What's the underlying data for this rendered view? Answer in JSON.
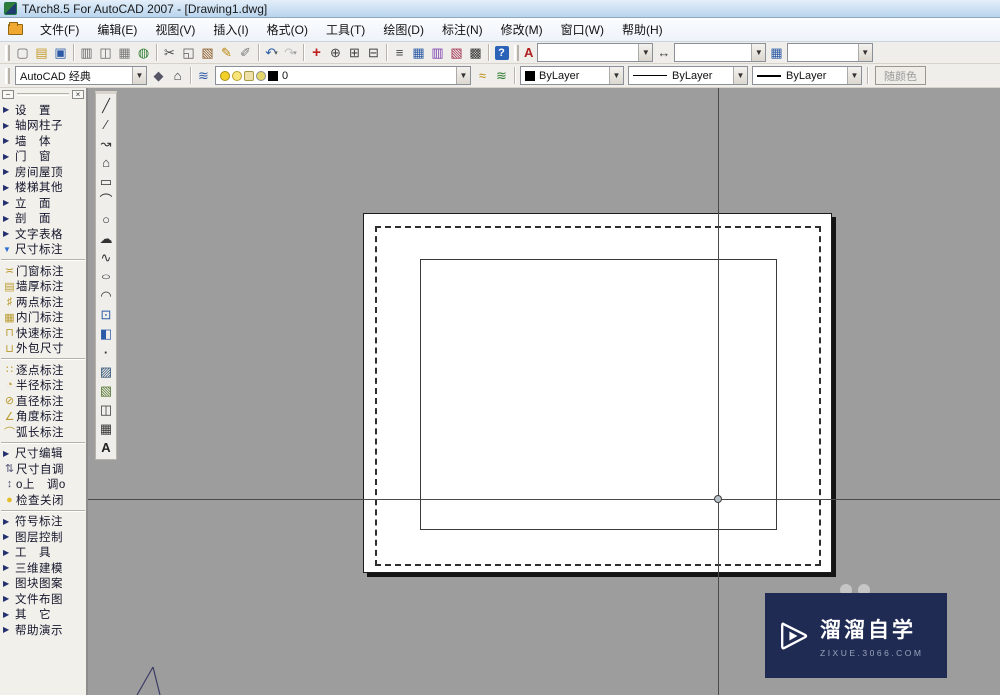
{
  "window": {
    "title": "TArch8.5 For AutoCAD 2007 - [Drawing1.dwg]"
  },
  "menu": {
    "items": [
      {
        "key": "file",
        "label": "文件(F)"
      },
      {
        "key": "edit",
        "label": "编辑(E)"
      },
      {
        "key": "view",
        "label": "视图(V)"
      },
      {
        "key": "insert",
        "label": "插入(I)"
      },
      {
        "key": "format",
        "label": "格式(O)"
      },
      {
        "key": "tools",
        "label": "工具(T)"
      },
      {
        "key": "draw",
        "label": "绘图(D)"
      },
      {
        "key": "dimension",
        "label": "标注(N)"
      },
      {
        "key": "modify",
        "label": "修改(M)"
      },
      {
        "key": "window",
        "label": "窗口(W)"
      },
      {
        "key": "help",
        "label": "帮助(H)"
      }
    ]
  },
  "toolbars": {
    "standard": {
      "items": [
        {
          "key": "new-file",
          "glyph": "▢",
          "color": "#6a6a6a"
        },
        {
          "key": "open-file",
          "glyph": "▤",
          "color": "#c49a2c"
        },
        {
          "key": "save-file",
          "glyph": "▣",
          "color": "#2b5aa6"
        },
        {
          "sep": true
        },
        {
          "key": "plot",
          "glyph": "▥",
          "color": "#666666"
        },
        {
          "key": "plot-preview",
          "glyph": "◫",
          "color": "#666666"
        },
        {
          "key": "publish",
          "glyph": "▦",
          "color": "#777777"
        },
        {
          "key": "web",
          "glyph": "◍",
          "color": "#2e7d32"
        },
        {
          "sep": true
        },
        {
          "key": "cut",
          "glyph": "✂",
          "color": "#444444"
        },
        {
          "key": "copy",
          "glyph": "◱",
          "color": "#555555"
        },
        {
          "key": "paste",
          "glyph": "▧",
          "color": "#8b5a2b"
        },
        {
          "key": "match-properties",
          "glyph": "✎",
          "color": "#b8860b"
        },
        {
          "key": "block-editor",
          "glyph": "✐",
          "color": "#7a7a7a"
        },
        {
          "sep": true
        },
        {
          "key": "undo",
          "glyph": "↶",
          "color": "#2b5aa6",
          "dropdown": true
        },
        {
          "key": "redo",
          "glyph": "↷",
          "color": "#9a9a9a",
          "dropdown": true,
          "disabled": true
        },
        {
          "sep": true
        },
        {
          "key": "pan",
          "glyph": "+",
          "color": "#c02020",
          "cls": "bold"
        },
        {
          "key": "zoom-realtime",
          "glyph": "⊕",
          "color": "#444444"
        },
        {
          "key": "zoom-window",
          "glyph": "⊞",
          "color": "#444444"
        },
        {
          "key": "zoom-previous",
          "glyph": "⊟",
          "color": "#444444"
        },
        {
          "sep": true
        },
        {
          "key": "properties",
          "glyph": "≡",
          "color": "#444444"
        },
        {
          "key": "designcenter",
          "glyph": "▦",
          "color": "#2b5aa6"
        },
        {
          "key": "tool-palettes",
          "glyph": "▥",
          "color": "#7a3db0"
        },
        {
          "key": "markup",
          "glyph": "▧",
          "color": "#a03050"
        },
        {
          "key": "quickcalc",
          "glyph": "▩",
          "color": "#333333"
        },
        {
          "sep": true
        },
        {
          "key": "help",
          "glyph": "?",
          "cls": "help"
        }
      ]
    },
    "styles": {
      "text_style": "",
      "dim_style": "",
      "table_style": ""
    },
    "workspace": {
      "value": "AutoCAD 经典"
    },
    "layers": {
      "current_layer": "0"
    },
    "properties": {
      "color": "ByLayer",
      "linetype": "ByLayer",
      "lineweight": "ByLayer",
      "plot_style": "随颜色"
    }
  },
  "draw_toolbar": {
    "items": [
      {
        "key": "line",
        "glyph": "╱",
        "color": "#333333"
      },
      {
        "key": "construction-line",
        "glyph": "∕",
        "color": "#333333"
      },
      {
        "key": "polyline",
        "glyph": "↝",
        "color": "#333333"
      },
      {
        "key": "polygon",
        "glyph": "⌂",
        "color": "#333333"
      },
      {
        "key": "rectangle",
        "glyph": "▭",
        "color": "#333333"
      },
      {
        "key": "arc",
        "glyph": "⌒",
        "color": "#333333"
      },
      {
        "key": "circle",
        "glyph": "○",
        "color": "#333333"
      },
      {
        "key": "revision-cloud",
        "glyph": "☁",
        "color": "#333333"
      },
      {
        "key": "spline",
        "glyph": "∿",
        "color": "#333333"
      },
      {
        "key": "ellipse",
        "glyph": "○",
        "color": "#333333",
        "cls": "stretch"
      },
      {
        "key": "ellipse-arc",
        "glyph": "◠",
        "color": "#333333"
      },
      {
        "key": "insert-block",
        "glyph": "⊡",
        "color": "#2b5aa6"
      },
      {
        "key": "make-block",
        "glyph": "◧",
        "color": "#2b5aa6"
      },
      {
        "key": "point",
        "glyph": "·",
        "color": "#333333",
        "cls": "bold"
      },
      {
        "key": "hatch",
        "glyph": "▨",
        "color": "#335577"
      },
      {
        "key": "gradient",
        "glyph": "▧",
        "color": "#557733"
      },
      {
        "key": "region",
        "glyph": "◫",
        "color": "#333333"
      },
      {
        "key": "table",
        "glyph": "▦",
        "color": "#333333"
      },
      {
        "key": "mtext",
        "glyph": "A",
        "color": "#222222",
        "cls": "bold"
      }
    ]
  },
  "sidebar": {
    "items": [
      {
        "type": "group",
        "key": "settings",
        "label": "设　置"
      },
      {
        "type": "group",
        "key": "axis-grid-column",
        "label": "轴网柱子"
      },
      {
        "type": "group",
        "key": "wall",
        "label": "墙　体"
      },
      {
        "type": "group",
        "key": "door-window",
        "label": "门　窗"
      },
      {
        "type": "group",
        "key": "room-roof",
        "label": "房间屋顶"
      },
      {
        "type": "group",
        "key": "stairs-other",
        "label": "楼梯其他"
      },
      {
        "type": "group",
        "key": "elevation",
        "label": "立　面"
      },
      {
        "type": "group",
        "key": "section",
        "label": "剖　面"
      },
      {
        "type": "group",
        "key": "text-table",
        "label": "文字表格"
      },
      {
        "type": "group",
        "key": "dimension",
        "label": "尺寸标注",
        "expanded": true
      },
      {
        "type": "sep"
      },
      {
        "type": "tool",
        "key": "door-window-dim",
        "label": "门窗标注",
        "glyph": "≍",
        "color": "#b99a2e"
      },
      {
        "type": "tool",
        "key": "wall-thickness-dim",
        "label": "墙厚标注",
        "glyph": "▤",
        "color": "#b99a2e"
      },
      {
        "type": "tool",
        "key": "two-point-dim",
        "label": "两点标注",
        "glyph": "♯",
        "color": "#b99a2e"
      },
      {
        "type": "tool",
        "key": "inner-door-dim",
        "label": "内门标注",
        "glyph": "▦",
        "color": "#b99a2e"
      },
      {
        "type": "tool",
        "key": "quick-dim",
        "label": "快速标注",
        "glyph": "⊓",
        "color": "#b99a2e"
      },
      {
        "type": "tool",
        "key": "outer-dim",
        "label": "外包尺寸",
        "glyph": "⊔",
        "color": "#b99a2e"
      },
      {
        "type": "sep"
      },
      {
        "type": "tool",
        "key": "point-by-point-dim",
        "label": "逐点标注",
        "glyph": "∷",
        "color": "#b99a2e"
      },
      {
        "type": "tool",
        "key": "radius-dim",
        "label": "半径标注",
        "glyph": "◔",
        "color": "#b99a2e"
      },
      {
        "type": "tool",
        "key": "diameter-dim",
        "label": "直径标注",
        "glyph": "⊘",
        "color": "#b99a2e"
      },
      {
        "type": "tool",
        "key": "angle-dim",
        "label": "角度标注",
        "glyph": "∠",
        "color": "#b99a2e"
      },
      {
        "type": "tool",
        "key": "arc-length-dim",
        "label": "弧长标注",
        "glyph": "⌒",
        "color": "#b99a2e"
      },
      {
        "type": "sep"
      },
      {
        "type": "group",
        "key": "dim-edit",
        "label": "尺寸编辑"
      },
      {
        "type": "tool",
        "key": "dim-auto-adjust",
        "label": "尺寸自调",
        "glyph": "⇅",
        "color": "#555577"
      },
      {
        "type": "tool",
        "key": "adjust-toggle",
        "label": "o上　调o",
        "glyph": "↕",
        "color": "#555577"
      },
      {
        "type": "tool",
        "key": "check-close",
        "label": "检查关闭",
        "glyph": "●",
        "color": "#e3bd2a"
      },
      {
        "type": "sep"
      },
      {
        "type": "group",
        "key": "symbol-dim",
        "label": "符号标注"
      },
      {
        "type": "group",
        "key": "layer-control",
        "label": "图层控制"
      },
      {
        "type": "group",
        "key": "tools",
        "label": "工　具"
      },
      {
        "type": "group",
        "key": "3d-modeling",
        "label": "三维建模"
      },
      {
        "type": "group",
        "key": "block-pattern",
        "label": "图块图案"
      },
      {
        "type": "group",
        "key": "file-layout",
        "label": "文件布图"
      },
      {
        "type": "group",
        "key": "other",
        "label": "其　它"
      },
      {
        "type": "group",
        "key": "help-demo",
        "label": "帮助演示"
      }
    ]
  },
  "watermark": {
    "brand": "溜溜自学",
    "url": "ZIXUE.3066.COM"
  }
}
